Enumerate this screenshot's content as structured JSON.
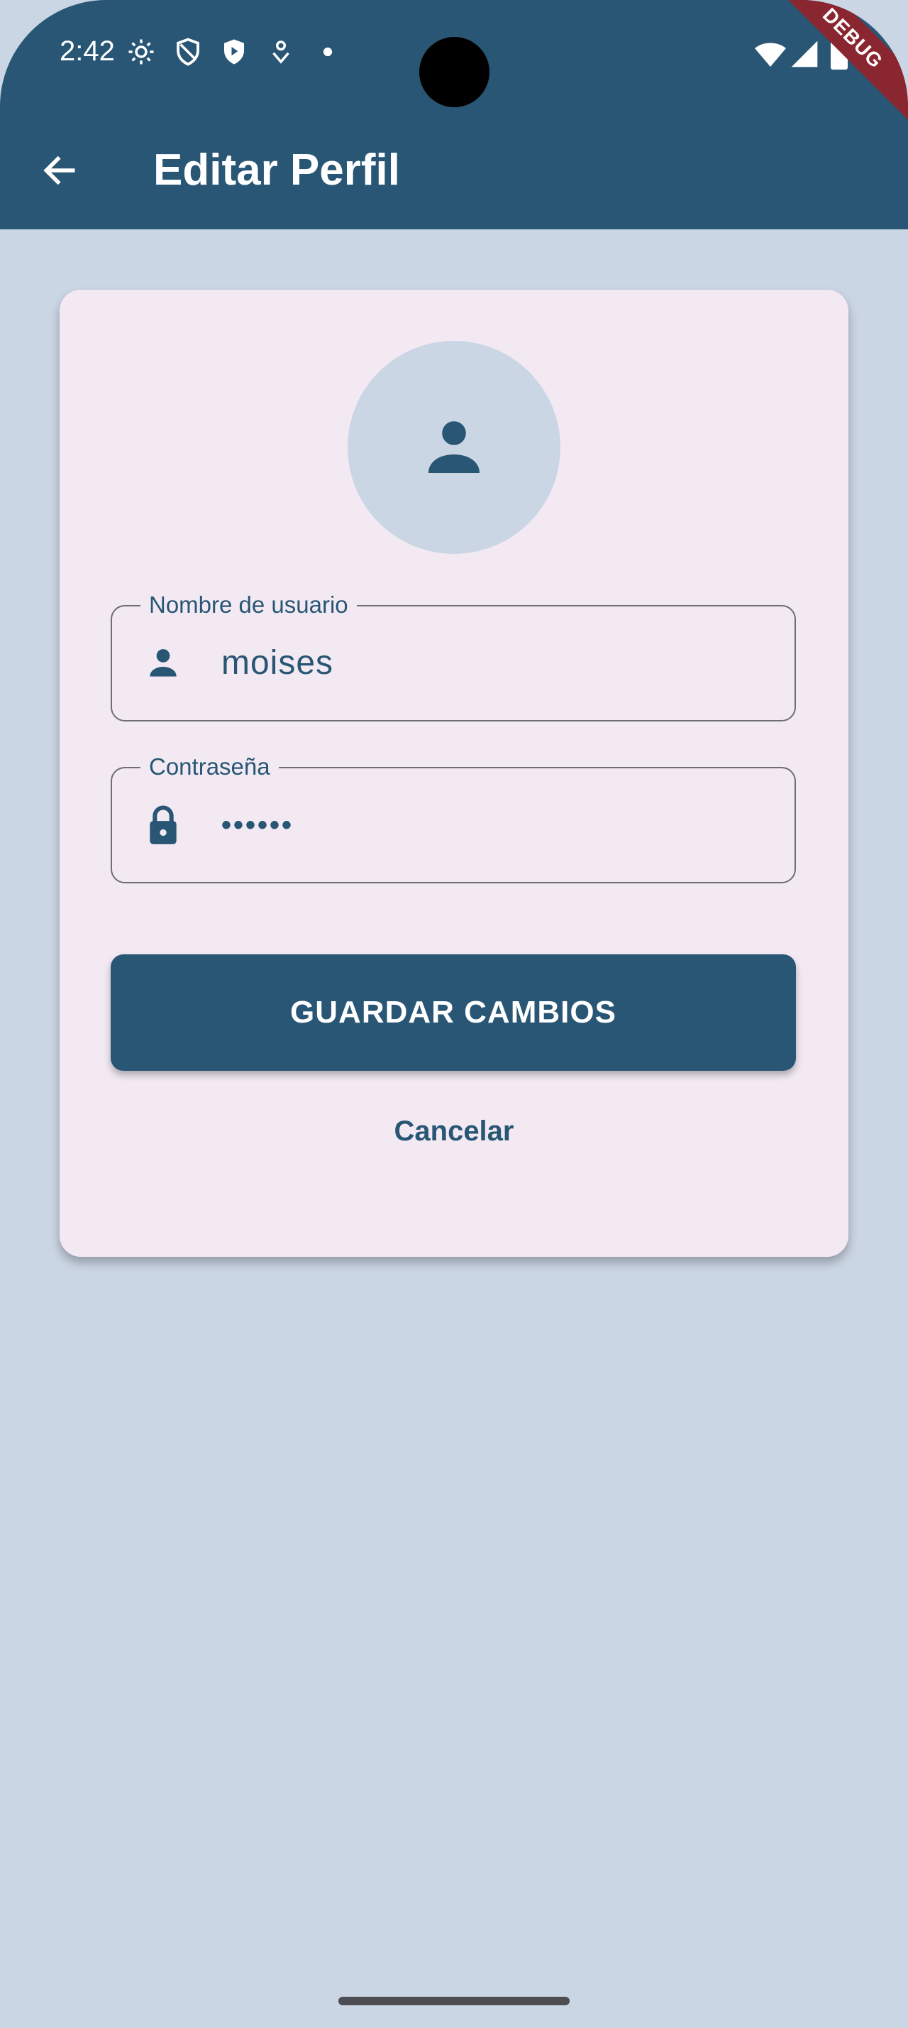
{
  "status_bar": {
    "time": "2:42",
    "left_icons": [
      "gear-icon",
      "shield-outline-icon",
      "shield-play-icon",
      "location-pin-icon",
      "dot-icon"
    ],
    "right_icons": [
      "wifi-icon",
      "signal-icon",
      "battery-icon"
    ]
  },
  "debug_banner": "DEBUG",
  "app_bar": {
    "back_icon": "arrow-back-icon",
    "title": "Editar Perfil"
  },
  "profile": {
    "avatar_icon": "person-icon"
  },
  "form": {
    "username": {
      "label": "Nombre de usuario",
      "value": "moises",
      "icon": "person-icon"
    },
    "password": {
      "label": "Contraseña",
      "value": "••••••",
      "icon": "lock-icon"
    }
  },
  "actions": {
    "save_label": "GUARDAR CAMBIOS",
    "cancel_label": "Cancelar"
  },
  "colors": {
    "primary": "#285674",
    "background": "#cbd6e4",
    "card": "#f2e9f3",
    "debug": "#8a2630"
  }
}
